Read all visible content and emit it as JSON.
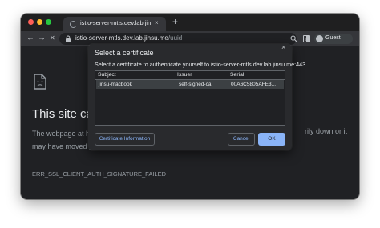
{
  "browser": {
    "tab": {
      "title": "istio-server-mtls.dev.lab.jinsu.me",
      "close": "×"
    },
    "new_tab": "+",
    "nav": {
      "back": "←",
      "forward": "→",
      "stop": "✕"
    },
    "url": {
      "host": "istio-server-mtls.dev.lab.jinsu.me",
      "path": "/uuid"
    },
    "star": "☆",
    "profile_label": "Guest"
  },
  "error_page": {
    "title": "This site can",
    "description_line1": "The webpage at h",
    "description_right": "rily down or it",
    "description_line2": "may have moved p",
    "code": "ERR_SSL_CLIENT_AUTH_SIGNATURE_FAILED"
  },
  "dialog": {
    "title": "Select a certificate",
    "close": "×",
    "subtitle": "Select a certificate to authenticate yourself to istio-server-mtls.dev.lab.jinsu.me:443",
    "columns": [
      "Subject",
      "Issuer",
      "Serial"
    ],
    "rows": [
      {
        "subject": "jinsu-macbook",
        "issuer": "self-signed-ca",
        "serial": "00A6C5805AFE3..."
      }
    ],
    "info_button": "Certificate Information",
    "cancel_button": "Cancel",
    "ok_button": "OK"
  },
  "colors": {
    "window_bg": "#202124",
    "toolbar_bg": "#35363a",
    "accent": "#8ab4f8",
    "selected_row": "#3c4043"
  }
}
